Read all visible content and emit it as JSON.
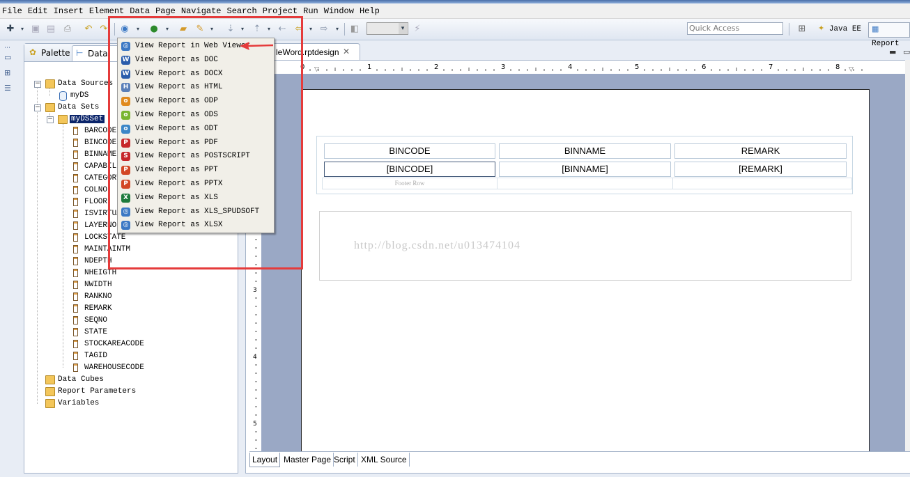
{
  "menu": [
    "File",
    "Edit",
    "Insert",
    "Element",
    "Data",
    "Page",
    "Navigate",
    "Search",
    "Project",
    "Run",
    "Window",
    "Help"
  ],
  "toolbar": {
    "quick_access_placeholder": "Quick Access",
    "perspectives": [
      "Java EE",
      "Report"
    ]
  },
  "left_panel": {
    "tabs": [
      "Palette",
      "Data Ex..."
    ],
    "tree": {
      "data_sources": "Data Sources",
      "data_source": "myDS",
      "data_sets": "Data Sets",
      "data_set": "myDSSet",
      "columns": [
        "BARCODE",
        "BINCODE",
        "BINNAME",
        "CAPABILI",
        "CATEGORY",
        "COLNO",
        "FLOOR",
        "ISVIRTUA",
        "LAYERNO",
        "LOCKSTATE",
        "MAINTAINTM",
        "NDEPTH",
        "NHEIGTH",
        "NWIDTH",
        "RANKNO",
        "REMARK",
        "SEQNO",
        "STATE",
        "STOCKAREACODE",
        "TAGID",
        "WAREHOUSECODE"
      ],
      "data_cubes": "Data Cubes",
      "report_parameters": "Report Parameters",
      "variables": "Variables"
    }
  },
  "editor": {
    "tab_title": "leWord.rptdesign",
    "ruler_marks": [
      "0",
      "1",
      "2",
      "3",
      "4",
      "5",
      "6",
      "7",
      "8"
    ],
    "ruler_v_marks": [
      "3",
      "4",
      "5"
    ],
    "table": {
      "headers": [
        "BINCODE",
        "BINNAME",
        "REMARK"
      ],
      "detail": [
        "[BINCODE]",
        "[BINNAME]",
        "[REMARK]"
      ],
      "footer_label": "Footer Row"
    },
    "watermark": "http://blog.csdn.net/u013474104",
    "bottom_tabs": [
      "Layout",
      "Master Page",
      "Script",
      "XML Source"
    ]
  },
  "dropdown": {
    "items": [
      {
        "label": "View Report in Web Viewer",
        "icon": "globe-icon",
        "color": "#3b78c4"
      },
      {
        "label": "View Report as DOC",
        "icon": "word-icon",
        "color": "#2a5cab"
      },
      {
        "label": "View Report as DOCX",
        "icon": "word-icon",
        "color": "#2a5cab"
      },
      {
        "label": "View Report as HTML",
        "icon": "html-icon",
        "color": "#5a7fb8"
      },
      {
        "label": "View Report as ODP",
        "icon": "odp-icon",
        "color": "#e08a1e"
      },
      {
        "label": "View Report as ODS",
        "icon": "ods-icon",
        "color": "#79b530"
      },
      {
        "label": "View Report as ODT",
        "icon": "odt-icon",
        "color": "#3b86c7"
      },
      {
        "label": "View Report as PDF",
        "icon": "pdf-icon",
        "color": "#c6272a"
      },
      {
        "label": "View Report as POSTSCRIPT",
        "icon": "postscript-icon",
        "color": "#c6272a"
      },
      {
        "label": "View Report as PPT",
        "icon": "ppt-icon",
        "color": "#d24726"
      },
      {
        "label": "View Report as PPTX",
        "icon": "pptx-icon",
        "color": "#d24726"
      },
      {
        "label": "View Report as XLS",
        "icon": "excel-icon",
        "color": "#1d7a3c"
      },
      {
        "label": "View Report as XLS_SPUDSOFT",
        "icon": "globe-icon",
        "color": "#3b78c4"
      },
      {
        "label": "View Report as XLSX",
        "icon": "globe-icon",
        "color": "#3b78c4"
      }
    ]
  },
  "annotation_color": "#e53b3b"
}
